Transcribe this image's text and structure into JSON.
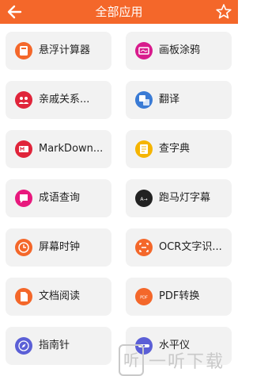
{
  "header": {
    "title": "全部应用",
    "back_icon": "back-arrow-icon",
    "star_icon": "star-outline-icon"
  },
  "apps": [
    {
      "label": "悬浮计算器",
      "icon": "calculator-icon",
      "color": "#f4672a"
    },
    {
      "label": "画板涂鸦",
      "icon": "drawing-board-icon",
      "color": "#d81b8c"
    },
    {
      "label": "亲戚关系...",
      "icon": "relatives-icon",
      "color": "#e0243a"
    },
    {
      "label": "翻译",
      "icon": "translate-icon",
      "color": "#3a7bd5"
    },
    {
      "label": "MarkDown...",
      "icon": "markdown-icon",
      "color": "#e0243a"
    },
    {
      "label": "查字典",
      "icon": "dictionary-icon",
      "color": "#f5b400"
    },
    {
      "label": "成语查询",
      "icon": "idiom-icon",
      "color": "#e8197d"
    },
    {
      "label": "跑马灯字幕",
      "icon": "marquee-icon",
      "color": "#222222"
    },
    {
      "label": "屏幕时钟",
      "icon": "clock-icon",
      "color": "#f4672a"
    },
    {
      "label": "OCR文字识...",
      "icon": "ocr-icon",
      "color": "#f4672a"
    },
    {
      "label": "文档阅读",
      "icon": "document-reader-icon",
      "color": "#f4672a"
    },
    {
      "label": "PDF转换",
      "icon": "pdf-icon",
      "color": "#f4672a"
    },
    {
      "label": "指南针",
      "icon": "compass-icon",
      "color": "#5b5fd6"
    },
    {
      "label": "水平仪",
      "icon": "level-icon",
      "color": "#5b5fd6"
    }
  ],
  "watermark": {
    "glyph": "听",
    "text": "一听下载"
  }
}
